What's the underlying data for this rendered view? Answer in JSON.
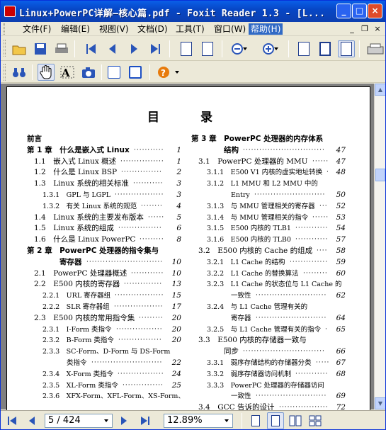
{
  "window": {
    "title": "Linux+PowerPC详解—核心篇.pdf - Foxit Reader 1.3 - [L...",
    "min": "_",
    "max": "□",
    "close": "×"
  },
  "menu": [
    {
      "label": "文件(F)"
    },
    {
      "label": "编辑(E)"
    },
    {
      "label": "视图(V)"
    },
    {
      "label": "文档(D)"
    },
    {
      "label": "工具(T)"
    },
    {
      "label": "窗口(W)"
    },
    {
      "label": "帮助(H)"
    }
  ],
  "mdi": {
    "min": "_",
    "restore": "❐",
    "close": "×"
  },
  "status": {
    "page": "5 / 424",
    "zoom": "12.89%"
  },
  "toc": {
    "heading": "目 录",
    "left": [
      {
        "label": "前言",
        "page": "",
        "level": 0,
        "bold": true
      },
      {
        "label": "第 1 章　什么是嵌入式 Linux",
        "page": "1",
        "level": 0,
        "bold": true
      },
      {
        "label": "1.1　嵌入式 Linux 概述",
        "page": "1",
        "level": 1
      },
      {
        "label": "1.2　什么是 Linux BSP",
        "page": "2",
        "level": 1
      },
      {
        "label": "1.3　Linux 系统的相关标准",
        "page": "3",
        "level": 1
      },
      {
        "label": "1.3.1　GPL 与 LGPL",
        "page": "3",
        "level": 2
      },
      {
        "label": "1.3.2　有关 Linux 系统的规范",
        "page": "4",
        "level": 2
      },
      {
        "label": "1.4　Linux 系统的主要发布版本",
        "page": "5",
        "level": 1
      },
      {
        "label": "1.5　Linux 系统的组成",
        "page": "6",
        "level": 1
      },
      {
        "label": "1.6　什么是 Linux PowerPC",
        "page": "8",
        "level": 1
      },
      {
        "label": "第 2 章　PowerPC 处理器的指令集与",
        "page": "",
        "level": 0,
        "bold": true
      },
      {
        "label": "寄存器",
        "page": "10",
        "level": 3,
        "bold": true
      },
      {
        "label": "2.1　PowerPC 处理器概述",
        "page": "10",
        "level": 1
      },
      {
        "label": "2.2　E500 内核的寄存器",
        "page": "13",
        "level": 1
      },
      {
        "label": "2.2.1　URL 寄存器组",
        "page": "15",
        "level": 2
      },
      {
        "label": "2.2.2　SLR 寄存器组",
        "page": "17",
        "level": 2
      },
      {
        "label": "2.3　E500 内核的常用指令集",
        "page": "20",
        "level": 1
      },
      {
        "label": "2.3.1　I-Form 类指令",
        "page": "20",
        "level": 2
      },
      {
        "label": "2.3.2　B-Form 类指令",
        "page": "20",
        "level": 2
      },
      {
        "label": "2.3.3　SC-Form、D-Form 与 DS-Form",
        "page": "",
        "level": 2
      },
      {
        "label": "类指令",
        "page": "22",
        "level": 4
      },
      {
        "label": "2.3.4　X-Form 类指令",
        "page": "24",
        "level": 2
      },
      {
        "label": "2.3.5　XL-Form 类指令",
        "page": "25",
        "level": 2
      },
      {
        "label": "2.3.6　XFX-Form、XFL-Form、XS-Form、",
        "page": "",
        "level": 2
      }
    ],
    "right": [
      {
        "label": "第 3 章　PowerPC 处理器的内存体系",
        "page": "",
        "level": 0,
        "bold": true
      },
      {
        "label": "结构",
        "page": "47",
        "level": 3,
        "bold": true
      },
      {
        "label": "3.1　PowerPC 处理器的 MMU",
        "page": "47",
        "level": 1
      },
      {
        "label": "3.1.1　E500 V1 内核的虚实地址转换",
        "page": "48",
        "level": 2
      },
      {
        "label": "3.1.2　L1 MMU 和 L2 MMU 中的",
        "page": "",
        "level": 2
      },
      {
        "label": "Entry",
        "page": "50",
        "level": 4
      },
      {
        "label": "3.1.3　与 MMU 管理相关的寄存器",
        "page": "52",
        "level": 2
      },
      {
        "label": "3.1.4　与 MMU 管理相关的指令",
        "page": "53",
        "level": 2
      },
      {
        "label": "3.1.5　E500 内核的 TLB1",
        "page": "54",
        "level": 2
      },
      {
        "label": "3.1.6　E500 内核的 TLB0",
        "page": "57",
        "level": 2
      },
      {
        "label": "3.2　E500 内核的 Cache 的组成",
        "page": "58",
        "level": 1
      },
      {
        "label": "3.2.1　L1 Cache 的结构",
        "page": "59",
        "level": 2
      },
      {
        "label": "3.2.2　L1 Cache 的替换算法",
        "page": "60",
        "level": 2
      },
      {
        "label": "3.2.3　L1 Cache 的状态位与 L1 Cache 的",
        "page": "",
        "level": 2
      },
      {
        "label": "一致性",
        "page": "62",
        "level": 4
      },
      {
        "label": "3.2.4　与 L1 Cache 管理有关的",
        "page": "",
        "level": 2
      },
      {
        "label": "寄存器",
        "page": "64",
        "level": 4
      },
      {
        "label": "3.2.5　与 L1 Cache 管理有关的指令",
        "page": "65",
        "level": 2
      },
      {
        "label": "3.3　E500 内核的存储器一致与",
        "page": "",
        "level": 1
      },
      {
        "label": "同步",
        "page": "66",
        "level": 3
      },
      {
        "label": "3.3.1　弱序存储结构的存储器分类",
        "page": "67",
        "level": 2
      },
      {
        "label": "3.3.2　弱序存储器访问机制",
        "page": "68",
        "level": 2
      },
      {
        "label": "3.3.3　PowerPC 处理器的存储器访问",
        "page": "",
        "level": 2
      },
      {
        "label": "一致性",
        "page": "69",
        "level": 4
      },
      {
        "label": "3.4　GCC 告诉的设计",
        "page": "72",
        "level": 1
      }
    ]
  }
}
